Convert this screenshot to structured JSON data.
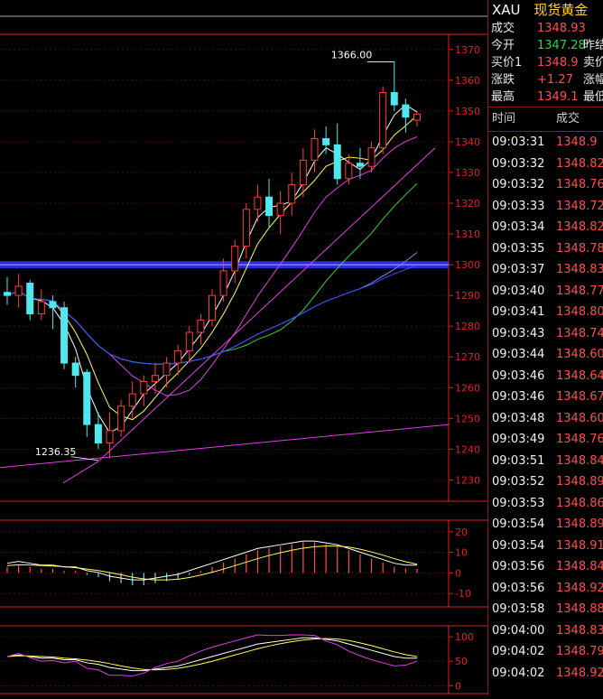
{
  "header": {
    "symbol": "XAU",
    "name": "现货黄金"
  },
  "quote": [
    {
      "label": "成交",
      "value": "1348.93",
      "color": "red",
      "label2": ""
    },
    {
      "label": "今开",
      "value": "1347.28",
      "color": "green",
      "label2": "昨结"
    },
    {
      "label": "买价1",
      "value": "1348.9",
      "color": "red",
      "label2": "卖价"
    },
    {
      "label": "涨跌",
      "value": "+1.27",
      "color": "red",
      "label2": "涨幅"
    },
    {
      "label": "最高",
      "value": "1349.1",
      "color": "red",
      "label2": "最低"
    }
  ],
  "ticks_header": {
    "time": "时间",
    "price": "成交"
  },
  "ticks": [
    {
      "time": "09:03:31",
      "price": "1348.9"
    },
    {
      "time": "09:03:32",
      "price": "1348.82"
    },
    {
      "time": "09:03:32",
      "price": "1348.76"
    },
    {
      "time": "09:03:33",
      "price": "1348.72"
    },
    {
      "time": "09:03:34",
      "price": "1348.82"
    },
    {
      "time": "09:03:35",
      "price": "1348.78"
    },
    {
      "time": "09:03:37",
      "price": "1348.83"
    },
    {
      "time": "09:03:40",
      "price": "1348.77"
    },
    {
      "time": "09:03:41",
      "price": "1348.80"
    },
    {
      "time": "09:03:43",
      "price": "1348.74"
    },
    {
      "time": "09:03:44",
      "price": "1348.60"
    },
    {
      "time": "09:03:46",
      "price": "1348.64"
    },
    {
      "time": "09:03:46",
      "price": "1348.67"
    },
    {
      "time": "09:03:48",
      "price": "1348.60"
    },
    {
      "time": "09:03:49",
      "price": "1348.76"
    },
    {
      "time": "09:03:51",
      "price": "1348.84"
    },
    {
      "time": "09:03:52",
      "price": "1348.89"
    },
    {
      "time": "09:03:53",
      "price": "1348.86"
    },
    {
      "time": "09:03:54",
      "price": "1348.89"
    },
    {
      "time": "09:03:54",
      "price": "1348.91"
    },
    {
      "time": "09:03:56",
      "price": "1348.84"
    },
    {
      "time": "09:03:56",
      "price": "1348.92"
    },
    {
      "time": "09:03:58",
      "price": "1348.88"
    },
    {
      "time": "09:04:00",
      "price": "1348.83"
    },
    {
      "time": "09:04:02",
      "price": "1348.79"
    },
    {
      "time": "09:04:02",
      "price": "1348.92"
    }
  ],
  "chart_data": [
    {
      "type": "candlestick",
      "y_ticks": [
        "1370",
        "1360",
        "1350",
        "1340",
        "1330",
        "1320",
        "1310",
        "1300",
        "1290",
        "1280",
        "1270",
        "1260",
        "1250",
        "1240",
        "1230"
      ],
      "ylim": [
        1226,
        1372
      ],
      "annotations": [
        {
          "text": "1366.00",
          "value": 1366.0,
          "bar": 34
        },
        {
          "text": "1236.35",
          "value": 1236.35,
          "bar": 8
        }
      ],
      "candles": [
        [
          1291,
          1296,
          1287,
          1290
        ],
        [
          1290,
          1297,
          1286,
          1293
        ],
        [
          1294,
          1295,
          1282,
          1284
        ],
        [
          1284,
          1292,
          1282,
          1288
        ],
        [
          1288,
          1290,
          1279,
          1286
        ],
        [
          1286,
          1288,
          1266,
          1268
        ],
        [
          1268,
          1270,
          1260,
          1264
        ],
        [
          1265,
          1266,
          1244,
          1248
        ],
        [
          1248,
          1252,
          1240,
          1242
        ],
        [
          1242,
          1252,
          1237,
          1246
        ],
        [
          1246,
          1256,
          1244,
          1254
        ],
        [
          1254,
          1262,
          1250,
          1258
        ],
        [
          1258,
          1264,
          1254,
          1262
        ],
        [
          1262,
          1268,
          1258,
          1264
        ],
        [
          1264,
          1270,
          1260,
          1268
        ],
        [
          1268,
          1274,
          1264,
          1272
        ],
        [
          1272,
          1280,
          1268,
          1278
        ],
        [
          1278,
          1284,
          1274,
          1282
        ],
        [
          1282,
          1292,
          1280,
          1290
        ],
        [
          1290,
          1302,
          1288,
          1298
        ],
        [
          1298,
          1308,
          1294,
          1306
        ],
        [
          1306,
          1320,
          1302,
          1318
        ],
        [
          1318,
          1326,
          1314,
          1322
        ],
        [
          1322,
          1328,
          1312,
          1316
        ],
        [
          1316,
          1324,
          1310,
          1320
        ],
        [
          1320,
          1330,
          1316,
          1326
        ],
        [
          1326,
          1338,
          1322,
          1334
        ],
        [
          1334,
          1344,
          1330,
          1341
        ],
        [
          1341,
          1345,
          1336,
          1339
        ],
        [
          1339,
          1346,
          1326,
          1328
        ],
        [
          1328,
          1336,
          1326,
          1333
        ],
        [
          1333,
          1338,
          1328,
          1332
        ],
        [
          1332,
          1340,
          1330,
          1338
        ],
        [
          1338,
          1358,
          1336,
          1356
        ],
        [
          1356,
          1366,
          1350,
          1352
        ],
        [
          1352,
          1354,
          1343,
          1348
        ],
        [
          1347,
          1350,
          1345,
          1349
        ]
      ],
      "mark_line": 1300
    },
    {
      "type": "bar",
      "y_ticks": [
        "20",
        "10",
        "0",
        "-10"
      ],
      "ylim": [
        -13,
        23
      ],
      "values": [
        3,
        4,
        3,
        2,
        2,
        1,
        1,
        -1,
        -2,
        -4,
        -5,
        -6,
        -6,
        -5,
        -4,
        -3,
        -1,
        1,
        3,
        5,
        7,
        9,
        11,
        12,
        13,
        14,
        15,
        15,
        14,
        13,
        11,
        9,
        7,
        5,
        3,
        2,
        2
      ]
    },
    {
      "type": "line",
      "y_ticks": [
        "100",
        "50",
        "0"
      ],
      "ylim": [
        -5,
        115
      ]
    }
  ]
}
